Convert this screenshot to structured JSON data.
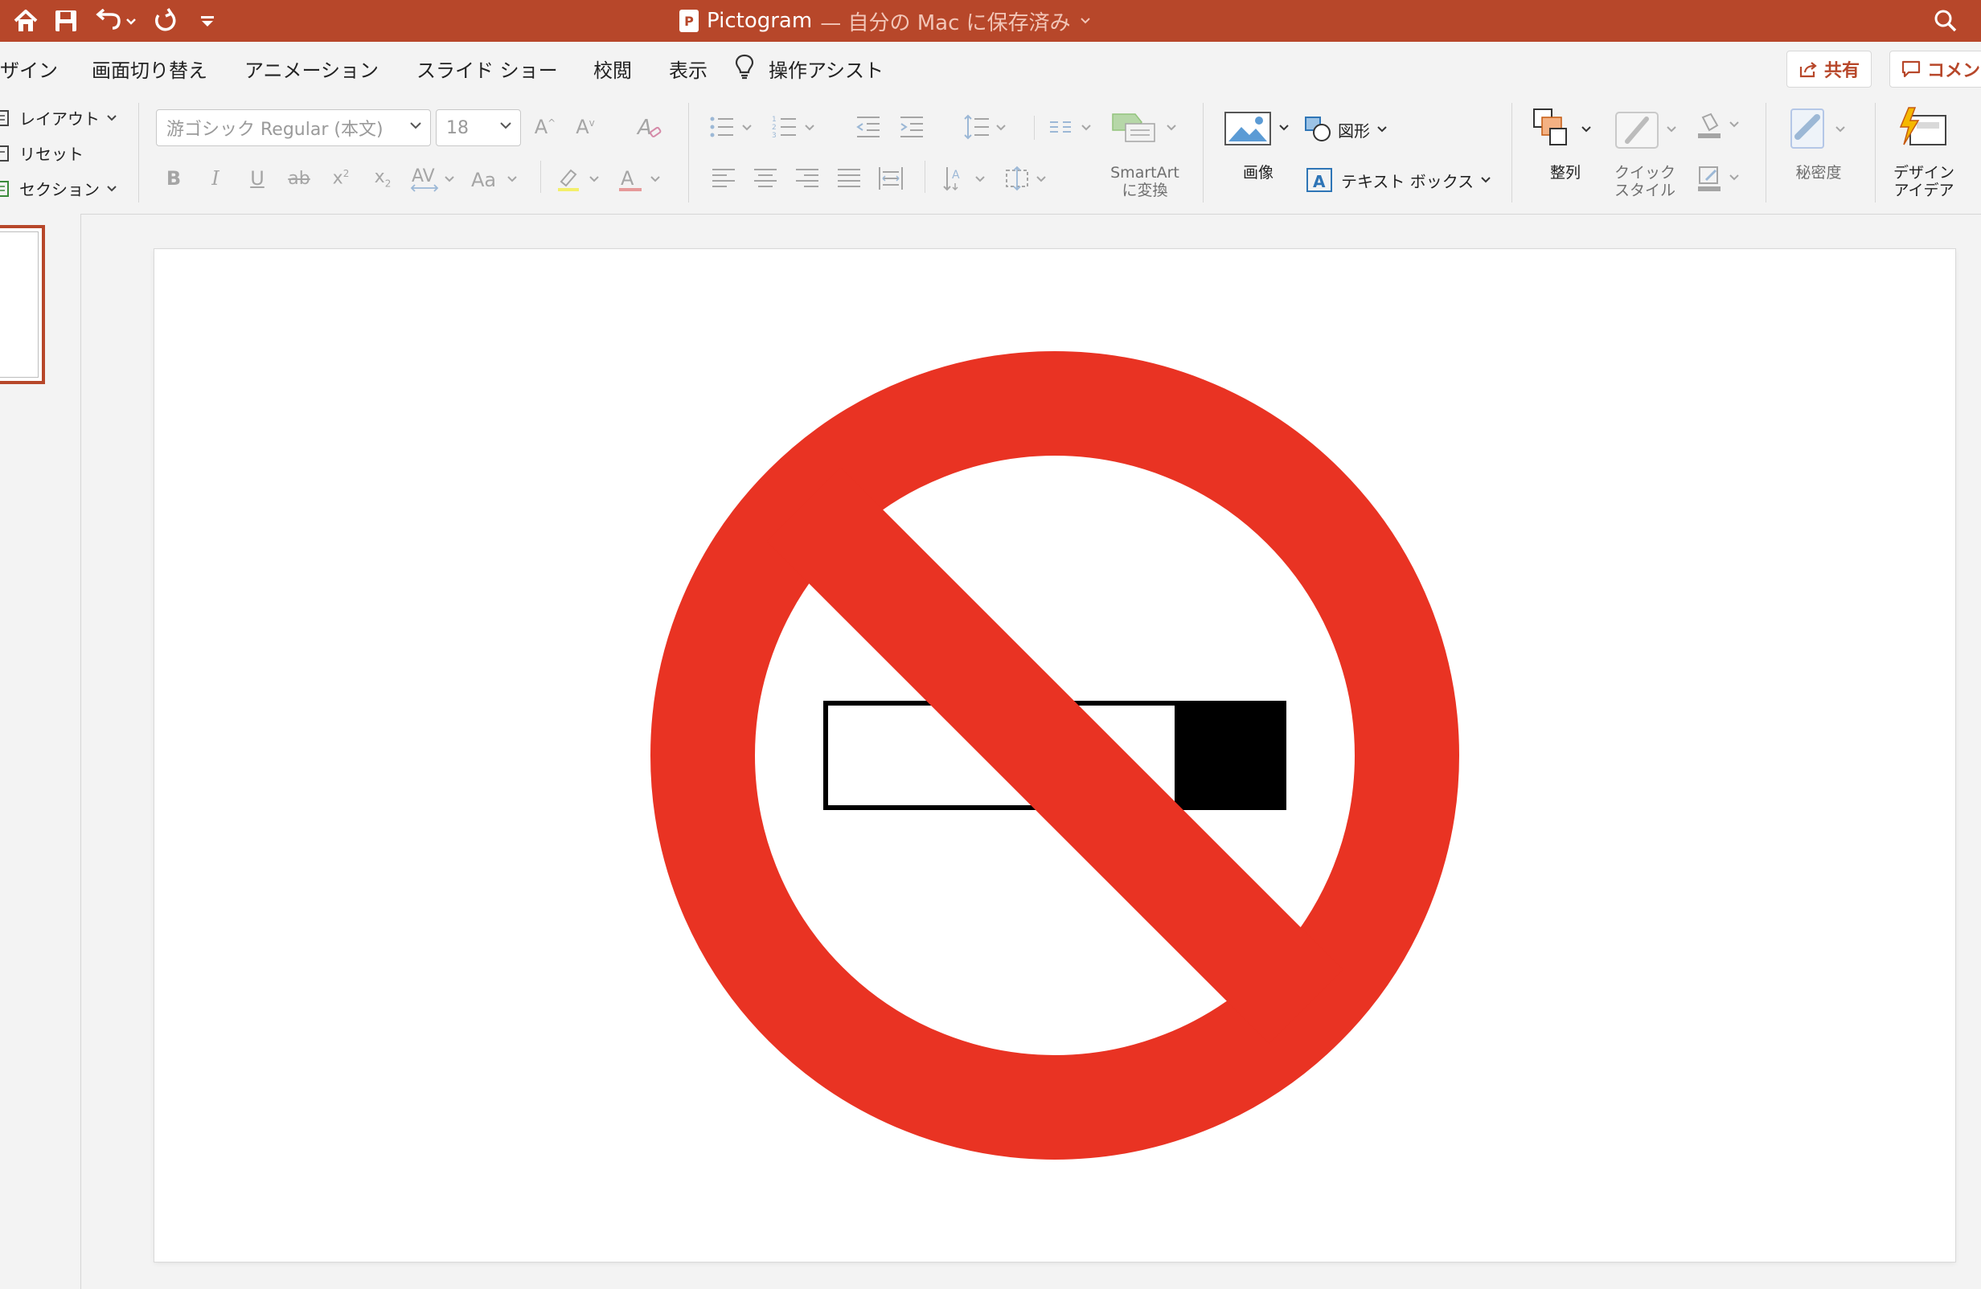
{
  "window": {
    "doc_name": "Pictogram",
    "save_status": "— 自分の Mac に保存済み",
    "accent_color": "#b7472a",
    "quick_access": [
      "home-icon",
      "save-icon",
      "undo-icon",
      "redo-icon",
      "customize-icon"
    ]
  },
  "tabs": [
    {
      "label": "ザイン"
    },
    {
      "label": "画面切り替え"
    },
    {
      "label": "アニメーション"
    },
    {
      "label": "スライド ショー"
    },
    {
      "label": "校閲"
    },
    {
      "label": "表示"
    },
    {
      "label": "操作アシスト"
    }
  ],
  "actions": {
    "share": "共有",
    "comment": "コメン"
  },
  "ribbon": {
    "slides": {
      "layout": "レイアウト",
      "reset": "リセット",
      "section": "セクション"
    },
    "font": {
      "name": "游ゴシック Regular (本文)",
      "size": "18"
    },
    "smartart": {
      "line1": "SmartArt",
      "line2": "に変換"
    },
    "image": "画像",
    "shapes": "図形",
    "textbox": "テキスト ボックス",
    "arrange": "整列",
    "quickstyle": {
      "line1": "クイック",
      "line2": "スタイル"
    },
    "sensitivity": "秘密度",
    "designer": {
      "line1": "デザイン",
      "line2": "アイデア"
    }
  },
  "slide": {
    "pictogram": "no-smoking-sign",
    "colors": {
      "prohibition_red": "#e93323",
      "cigarette_body": "#ffffff",
      "cigarette_filter": "#000000"
    }
  }
}
